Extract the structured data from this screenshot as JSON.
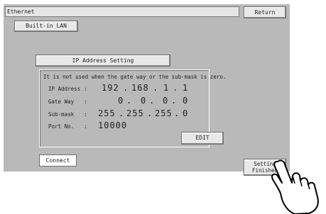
{
  "header": {
    "title": "Ethernet",
    "return_label": "Return"
  },
  "tabs": {
    "builtin_lan": "Built-in LAN"
  },
  "ip_section": {
    "button_label": "IP Address Setting",
    "note": "It is not used when the gate way or the sub-mask is zero.",
    "ip_address": {
      "label": "IP Address",
      "octets": [
        "192",
        "168",
        "1",
        "1"
      ]
    },
    "gateway": {
      "label": "Gate Way",
      "octets": [
        "0",
        "0",
        "0",
        "0"
      ]
    },
    "submask": {
      "label": "Sub-mask",
      "octets": [
        "255",
        "255",
        "255",
        "0"
      ]
    },
    "port": {
      "label": "Port No.",
      "value": "10000"
    },
    "edit_label": "EDIT"
  },
  "footer": {
    "connect_label": "Connect",
    "setting_finished_line1": "Setting",
    "setting_finished_line2": "Finished"
  },
  "icons": {
    "pointer": "pointing-hand-icon"
  },
  "colors": {
    "panel": "#b9b9b9",
    "button": "#e8e8e8"
  }
}
